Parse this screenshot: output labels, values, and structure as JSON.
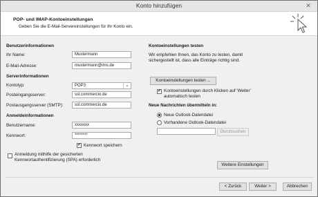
{
  "window": {
    "title": "Konto hinzufügen",
    "close_glyph": "✕"
  },
  "header": {
    "title": "POP- und IMAP-Kontoeinstellungen",
    "subtitle": "Geben Sie die E-Mail-Servereinstellungen für Ihr Konto ein."
  },
  "left": {
    "user_info": {
      "heading": "Benutzerinformationen",
      "name_label": "Ihr Name:",
      "name_value": "Mustermann",
      "email_label": "E-Mail-Adresse:",
      "email_value": "mustermann@ims.de"
    },
    "server_info": {
      "heading": "Serverinformationen",
      "type_label": "Kontotyp:",
      "type_value": "POP3",
      "incoming_label": "Posteingangsserver:",
      "incoming_value": "ssl.commercio.de",
      "outgoing_label": "Postausgangsserver (SMTP):",
      "outgoing_value": "ssl.commercio.de"
    },
    "login_info": {
      "heading": "Anmeldeinformationen",
      "user_label": "Benutzername:",
      "user_value": "xxxxxxx",
      "password_label": "Kennwort:",
      "password_value": "********",
      "remember_label": "Kennwort speichern",
      "spa_line1": "Anmeldung mithilfe der gesicherten",
      "spa_line2": "Kennwortauthentifizierung (SPA) erforderlich"
    }
  },
  "right": {
    "test_heading": "Kontoeinstellungen testen",
    "test_text1": "Wir empfehlen Ihnen, das Konto zu testen, damit",
    "test_text2": "sichergestellt ist, dass alle Einträge richtig sind.",
    "test_button": "Kontoeinstellungen testen ...",
    "auto_test_line1": "Kontoeinstellungen durch Klicken auf 'Weiter'",
    "auto_test_line2": "automatisch testen",
    "deliver_heading": "Neue Nachrichten übermitteln in:",
    "new_data_file": "Neue Outlook-Datendatei",
    "existing_data_file": "Vorhandene Outlook-Datendatei",
    "browse_button": "Durchsuchen",
    "more_settings_button": "Weitere Einstellungen"
  },
  "footer": {
    "back_button": "< Zurück",
    "next_button": "Weiter >",
    "cancel_button": "Abbrechen"
  },
  "state": {
    "remember_password": true,
    "spa_required": false,
    "auto_test": true,
    "deliver_option": "new"
  },
  "icons": {
    "checkmark": "✔",
    "dropdown_arrow": "⌄"
  }
}
